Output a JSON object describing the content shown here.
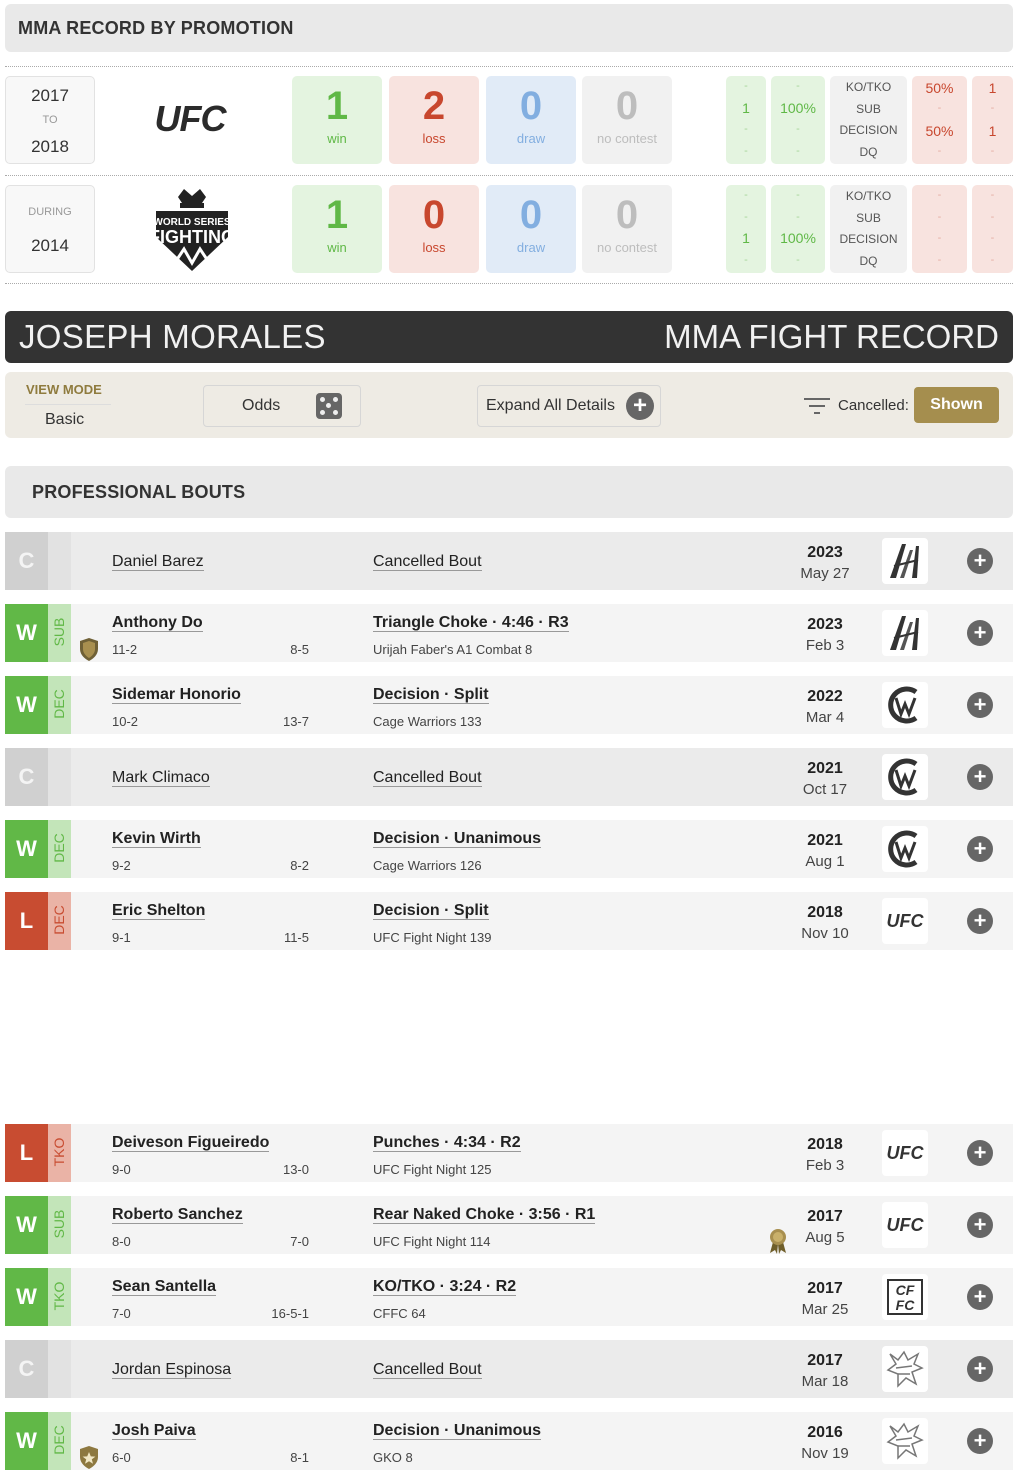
{
  "promo_section": {
    "title": "MMA RECORD BY PROMOTION",
    "rows": [
      {
        "year_top": "2017",
        "year_mid": "TO",
        "year_bottom": "2018",
        "logo": "ufc-logo",
        "win": "1",
        "win_label": "win",
        "loss": "2",
        "loss_label": "loss",
        "draw": "0",
        "draw_label": "draw",
        "nc": "0",
        "nc_label": "no contest",
        "methods": [
          "KO/TKO",
          "SUB",
          "DECISION",
          "DQ"
        ],
        "win_counts": [
          "-",
          "1",
          "-",
          "-"
        ],
        "win_pcts": [
          "-",
          "100%",
          "-",
          "-"
        ],
        "loss_pcts": [
          "50%",
          "-",
          "50%",
          "-"
        ],
        "loss_counts": [
          "1",
          "-",
          "1",
          "-"
        ]
      },
      {
        "year_top": "DURING",
        "year_mid": "",
        "year_bottom": "2014",
        "logo": "world-series-of-fighting-logo",
        "win": "1",
        "win_label": "win",
        "loss": "0",
        "loss_label": "loss",
        "draw": "0",
        "draw_label": "draw",
        "nc": "0",
        "nc_label": "no contest",
        "methods": [
          "KO/TKO",
          "SUB",
          "DECISION",
          "DQ"
        ],
        "win_counts": [
          "-",
          "-",
          "1",
          "-"
        ],
        "win_pcts": [
          "-",
          "-",
          "100%",
          "-"
        ],
        "loss_pcts": [
          "-",
          "-",
          "-",
          "-"
        ],
        "loss_counts": [
          "-",
          "-",
          "-",
          "-"
        ]
      }
    ]
  },
  "fighter": {
    "name": "JOSEPH MORALES",
    "record_title": "MMA FIGHT RECORD"
  },
  "toolbar": {
    "view_mode_label": "VIEW MODE",
    "view_mode_value": "Basic",
    "odds_label": "Odds",
    "expand_label": "Expand All Details",
    "cancelled_label": "Cancelled:",
    "shown_label": "Shown"
  },
  "bouts_section": {
    "title": "PROFESSIONAL BOUTS"
  },
  "bouts": [
    {
      "result": "C",
      "method_tag": "",
      "opponent": "Daniel Barez",
      "rec": "",
      "opp_rec": "",
      "method": "Cancelled Bout",
      "event": "",
      "year": "2023",
      "date": "May 27",
      "promo": "a1-combat"
    },
    {
      "result": "W",
      "method_tag": "SUB",
      "opponent": "Anthony Do",
      "rec": "11-2",
      "opp_rec": "8-5",
      "method": "Triangle Choke · 4:46 · R3",
      "event": "Urijah Faber's A1 Combat 8",
      "year": "2023",
      "date": "Feb 3",
      "promo": "a1-combat"
    },
    {
      "result": "W",
      "method_tag": "DEC",
      "opponent": "Sidemar Honorio",
      "rec": "10-2",
      "opp_rec": "13-7",
      "method": "Decision · Split",
      "event": "Cage Warriors 133",
      "year": "2022",
      "date": "Mar 4",
      "promo": "cage-warriors"
    },
    {
      "result": "C",
      "method_tag": "",
      "opponent": "Mark Climaco",
      "rec": "",
      "opp_rec": "",
      "method": "Cancelled Bout",
      "event": "",
      "year": "2021",
      "date": "Oct 17",
      "promo": "cage-warriors"
    },
    {
      "result": "W",
      "method_tag": "DEC",
      "opponent": "Kevin Wirth",
      "rec": "9-2",
      "opp_rec": "8-2",
      "method": "Decision · Unanimous",
      "event": "Cage Warriors 126",
      "year": "2021",
      "date": "Aug 1",
      "promo": "cage-warriors"
    },
    {
      "result": "L",
      "method_tag": "DEC",
      "opponent": "Eric Shelton",
      "rec": "9-1",
      "opp_rec": "11-5",
      "method": "Decision · Split",
      "event": "UFC Fight Night 139",
      "year": "2018",
      "date": "Nov 10",
      "promo": "ufc"
    },
    {
      "result": "L",
      "method_tag": "TKO",
      "opponent": "Deiveson Figueiredo",
      "rec": "9-0",
      "opp_rec": "13-0",
      "method": "Punches · 4:34 · R2",
      "event": "UFC Fight Night 125",
      "year": "2018",
      "date": "Feb 3",
      "promo": "ufc"
    },
    {
      "result": "W",
      "method_tag": "SUB",
      "opponent": "Roberto Sanchez",
      "rec": "8-0",
      "opp_rec": "7-0",
      "method": "Rear Naked Choke · 3:56 · R1",
      "event": "UFC Fight Night 114",
      "year": "2017",
      "date": "Aug 5",
      "promo": "ufc"
    },
    {
      "result": "W",
      "method_tag": "TKO",
      "opponent": "Sean Santella",
      "rec": "7-0",
      "opp_rec": "16-5-1",
      "method": "KO/TKO · 3:24 · R2",
      "event": "CFFC 64",
      "year": "2017",
      "date": "Mar 25",
      "promo": "cffc"
    },
    {
      "result": "C",
      "method_tag": "",
      "opponent": "Jordan Espinosa",
      "rec": "",
      "opp_rec": "",
      "method": "Cancelled Bout",
      "event": "",
      "year": "2017",
      "date": "Mar 18",
      "promo": "gko"
    },
    {
      "result": "W",
      "method_tag": "DEC",
      "opponent": "Josh Paiva",
      "rec": "6-0",
      "opp_rec": "8-1",
      "method": "Decision · Unanimous",
      "event": "GKO 8",
      "year": "2016",
      "date": "Nov 19",
      "promo": "gko"
    }
  ]
}
